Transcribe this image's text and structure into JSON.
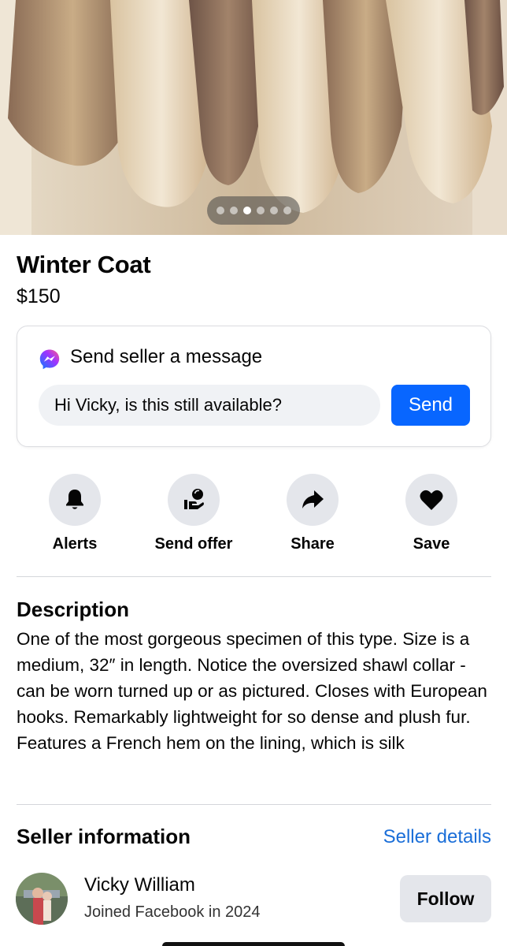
{
  "gallery": {
    "image_alt": "fur coat photo",
    "page_count": 6,
    "current_page": 3
  },
  "listing": {
    "title": "Winter Coat",
    "price": "$150"
  },
  "message": {
    "header": "Send seller a message",
    "icon": "messenger-icon",
    "input_value": "Hi Vicky, is this still available?",
    "send_label": "Send"
  },
  "actions": [
    {
      "label": "Alerts",
      "icon": "bell-icon"
    },
    {
      "label": "Send offer",
      "icon": "offer-icon"
    },
    {
      "label": "Share",
      "icon": "share-icon"
    },
    {
      "label": "Save",
      "icon": "heart-icon"
    }
  ],
  "description": {
    "heading": "Description",
    "text": "One of the most gorgeous specimen of this type.  Size is a medium, 32″ in length.  Notice the oversized shawl collar -  can be worn turned up or as pictured.  Closes with European hooks.  Remarkably lightweight for so dense and plush fur.   Features a French hem on the lining, which is silk"
  },
  "seller": {
    "heading": "Seller information",
    "details_link": "Seller details",
    "name": "Vicky William",
    "joined": "Joined Facebook in 2024",
    "follow_label": "Follow"
  },
  "colors": {
    "accent": "#0866ff",
    "link": "#1a6ed8",
    "button_gray": "#e4e6eb"
  }
}
